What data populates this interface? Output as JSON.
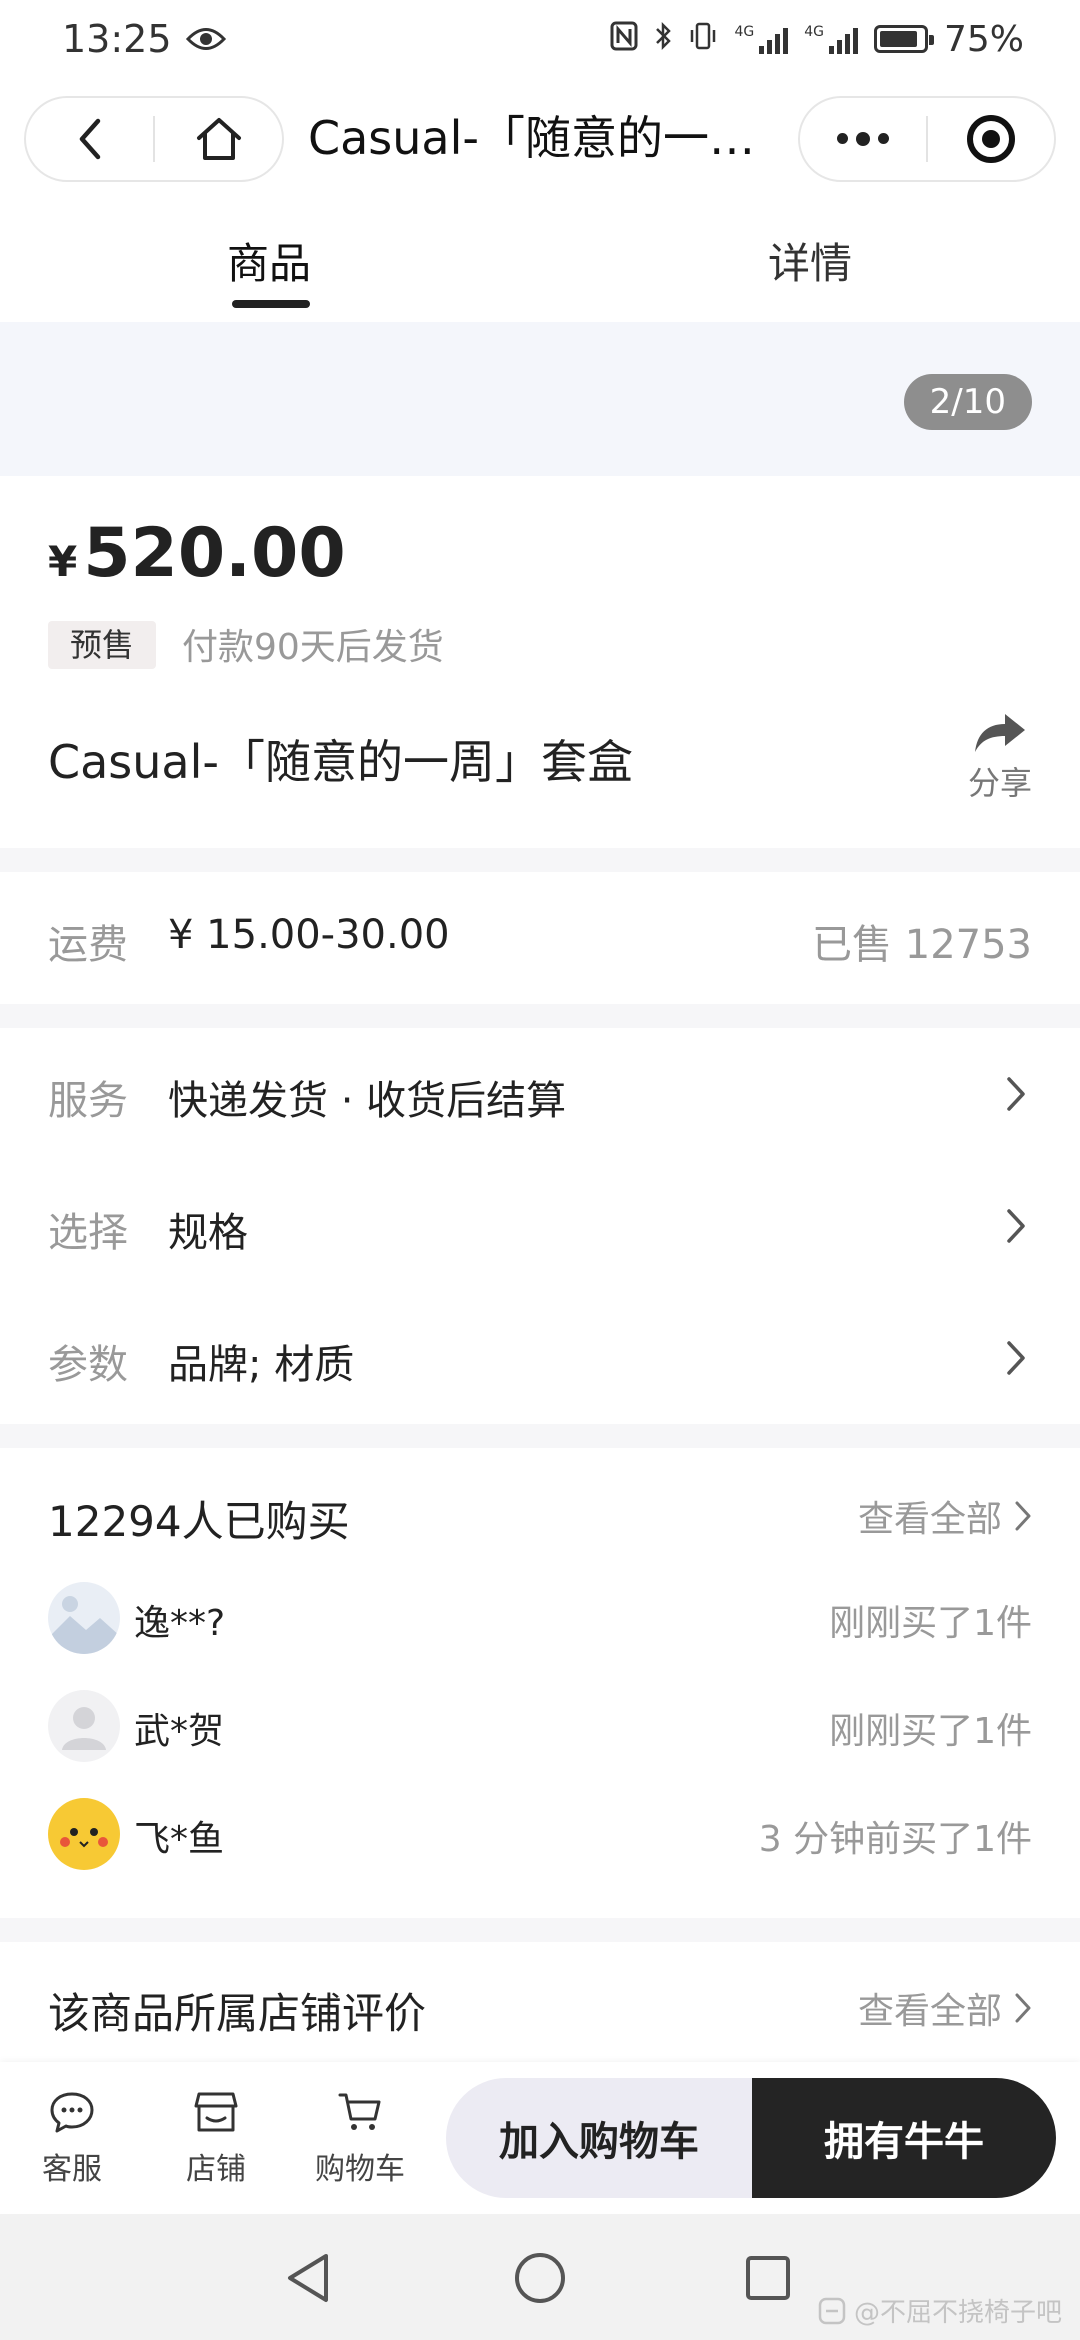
{
  "status_bar": {
    "time": "13:25",
    "battery": "75%",
    "net_label_1": "4G",
    "net_label_2": "4G"
  },
  "nav": {
    "title": "Casual-「随意的一…"
  },
  "tabs": {
    "goods": "商品",
    "detail": "详情"
  },
  "gallery": {
    "pager": "2/10"
  },
  "product": {
    "currency": "¥",
    "price": "520.00",
    "presale_tag": "预售",
    "presale_note": "付款90天后发货",
    "title": "Casual-「随意的一周」套盒",
    "share_label": "分享"
  },
  "shipping": {
    "label": "运费",
    "value": "¥ 15.00-30.00",
    "sold": "已售 12753"
  },
  "service": {
    "label": "服务",
    "value": "快递发货 · 收货后结算"
  },
  "select": {
    "label": "选择",
    "value": "规格"
  },
  "params": {
    "label": "参数",
    "value": "品牌; 材质"
  },
  "buyers": {
    "title": "12294人已购买",
    "see_all": "查看全部",
    "items": [
      {
        "name": "逸**?",
        "time": "刚刚买了1件"
      },
      {
        "name": "武*贺",
        "time": "刚刚买了1件"
      },
      {
        "name": "飞*鱼",
        "time": "3 分钟前买了1件"
      }
    ]
  },
  "reviews": {
    "title": "该商品所属店铺评价",
    "see_all": "查看全部"
  },
  "bottom_bar": {
    "service": "客服",
    "store": "店铺",
    "cart": "购物车",
    "add_to_cart": "加入购物车",
    "buy": "拥有牛牛"
  },
  "watermark": "@不屈不挠椅子吧",
  "colors": {
    "accent_dark": "#242424",
    "cart_button_bg": "#ecebf3",
    "pager_bg": "#8e8e8e",
    "gallery_bg": "#f4f6fb"
  }
}
